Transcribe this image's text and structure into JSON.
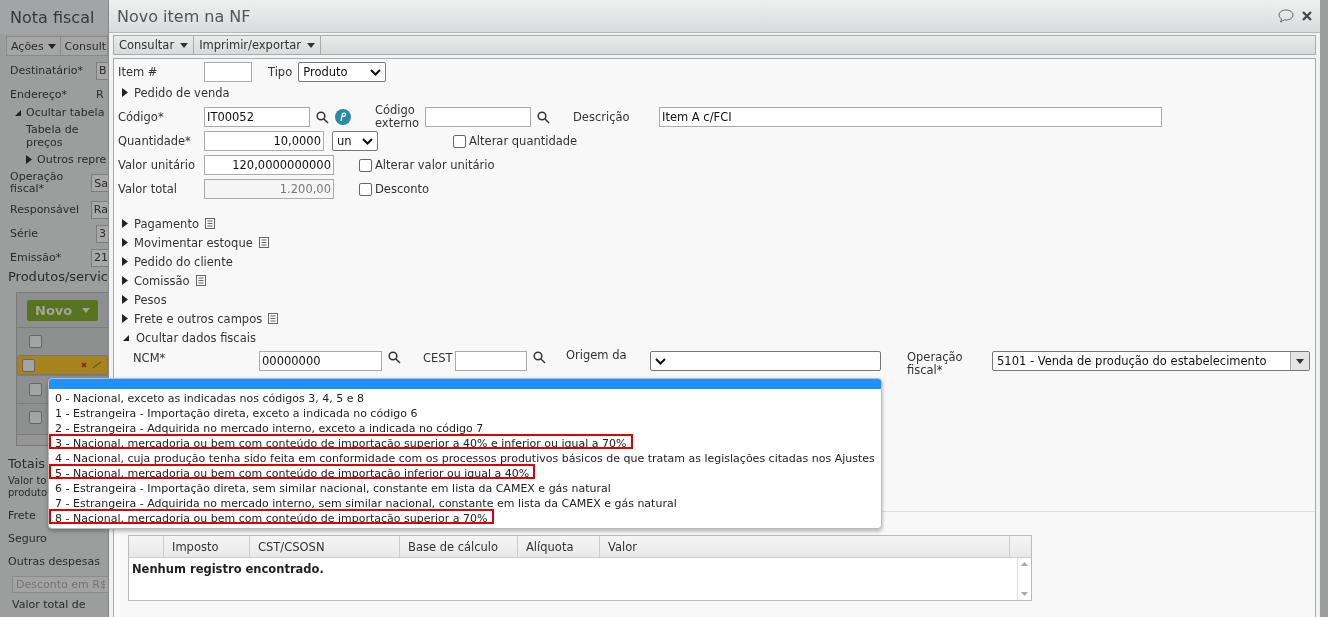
{
  "background": {
    "title": "Nota fiscal",
    "menu": [
      {
        "label": "Ações",
        "caret": true
      },
      {
        "label": "Consult",
        "caret": false
      }
    ],
    "fields": [
      {
        "label": "Destinatário*",
        "value": "B",
        "kind": "field"
      },
      {
        "label": "Endereço*",
        "value": "R",
        "kind": "text"
      }
    ],
    "price_table": {
      "toggle": "Ocultar tabela",
      "expanded": true,
      "label": "Tabela de preços",
      "other": "Outros repre"
    },
    "fields2": [
      {
        "label": "Operação fiscal*",
        "value": "Sa",
        "kind": "field"
      },
      {
        "label": "Responsável",
        "value": "Ra",
        "kind": "field"
      },
      {
        "label": "Série",
        "value": "3",
        "kind": "field"
      },
      {
        "label": "Emissão*",
        "value": "21",
        "kind": "field"
      }
    ],
    "products": {
      "title": "Produtos/servic",
      "new_button": "Novo",
      "select_all": {
        "checked": false
      },
      "rows": [
        {
          "selected": true,
          "checked": false
        },
        {
          "selected": false,
          "checked": false
        },
        {
          "selected": false,
          "checked": false
        }
      ]
    },
    "totals": {
      "title": "Totais",
      "labels": [
        "Valor to produto",
        "Frete",
        "Seguro",
        "Outras despesas"
      ],
      "discount_placeholder": "Desconto em R$",
      "last_label": "Valor total de"
    }
  },
  "dialog": {
    "title": "Novo item na NF",
    "menu": [
      {
        "label": "Consultar"
      },
      {
        "label": "Imprimir/exportar"
      }
    ],
    "item_number": {
      "label": "Item #"
    },
    "type": {
      "label": "Tipo",
      "value": "Produto"
    },
    "sales_order": {
      "label": "Pedido de venda",
      "expanded": false
    },
    "code": {
      "label": "Código*",
      "value": "IT00052"
    },
    "external_code": {
      "label": "Código externo"
    },
    "description": {
      "label": "Descrição",
      "value": "Item A c/FCI"
    },
    "quantity": {
      "label": "Quantidade*",
      "value": "10,0000",
      "unit": "un"
    },
    "change_quantity": {
      "label": "Alterar quantidade",
      "checked": false
    },
    "unit_price": {
      "label": "Valor unitário",
      "value": "120,0000000000"
    },
    "change_unit_price": {
      "label": "Alterar valor unitário",
      "checked": false
    },
    "total": {
      "label": "Valor total",
      "value": "1.200,00",
      "disabled": true
    },
    "discount": {
      "label": "Desconto",
      "checked": false
    },
    "sections": [
      {
        "label": "Pagamento",
        "expanded": false,
        "notes": true
      },
      {
        "label": "Movimentar estoque",
        "expanded": false,
        "notes": true
      },
      {
        "label": "Pedido do cliente",
        "expanded": false,
        "notes": false
      },
      {
        "label": "Comissão",
        "expanded": false,
        "notes": true
      },
      {
        "label": "Pesos",
        "expanded": false,
        "notes": false
      },
      {
        "label": "Frete e outros campos",
        "expanded": false,
        "notes": true
      },
      {
        "label": "Ocultar dados fiscais",
        "expanded": true,
        "notes": false
      }
    ],
    "fiscal": {
      "ncm": {
        "label": "NCM*",
        "value": "00000000"
      },
      "cest": {
        "label": "CEST"
      },
      "origin": {
        "label": "Origem da",
        "open": true,
        "options": [
          {
            "label": "0 - Nacional, exceto as indicadas nos códigos 3, 4, 5 e 8",
            "highlighted": false
          },
          {
            "label": "1 - Estrangeira - Importação direta, exceto a indicada no código 6",
            "highlighted": false
          },
          {
            "label": "2 - Estrangeira - Adquirida no mercado interno, exceto a indicada no código 7",
            "highlighted": false
          },
          {
            "label": "3 - Nacional, mercadoria ou bem com conteúdo de importação superior a 40% e inferior ou igual a 70%",
            "highlighted": true
          },
          {
            "label": "4 - Nacional, cuja produção tenha sido feita em conformidade com os processos produtivos básicos de que tratam as legislações citadas nos Ajustes",
            "highlighted": false
          },
          {
            "label": "5 - Nacional, mercadoria ou bem com conteúdo de importação inferior ou igual a 40%",
            "highlighted": true
          },
          {
            "label": "6 - Estrangeira - Importação direta, sem similar nacional, constante em lista da CAMEX e gás natural",
            "highlighted": false
          },
          {
            "label": "7 - Estrangeira - Adquirida no mercado interno, sem similar nacional, constante em lista da CAMEX e gás natural",
            "highlighted": false
          },
          {
            "label": "8 - Nacional, mercadoria ou bem com conteúdo de importação superior a 70%",
            "highlighted": true
          }
        ]
      },
      "operation": {
        "label": "Operação fiscal*",
        "value": "5101 - Venda de produção do estabelecimento"
      }
    },
    "taxes": {
      "columns": [
        "Imposto",
        "CST/CSOSN",
        "Base de cálculo",
        "Alíquota",
        "Valor"
      ],
      "empty_message": "Nenhum registro encontrado."
    }
  }
}
